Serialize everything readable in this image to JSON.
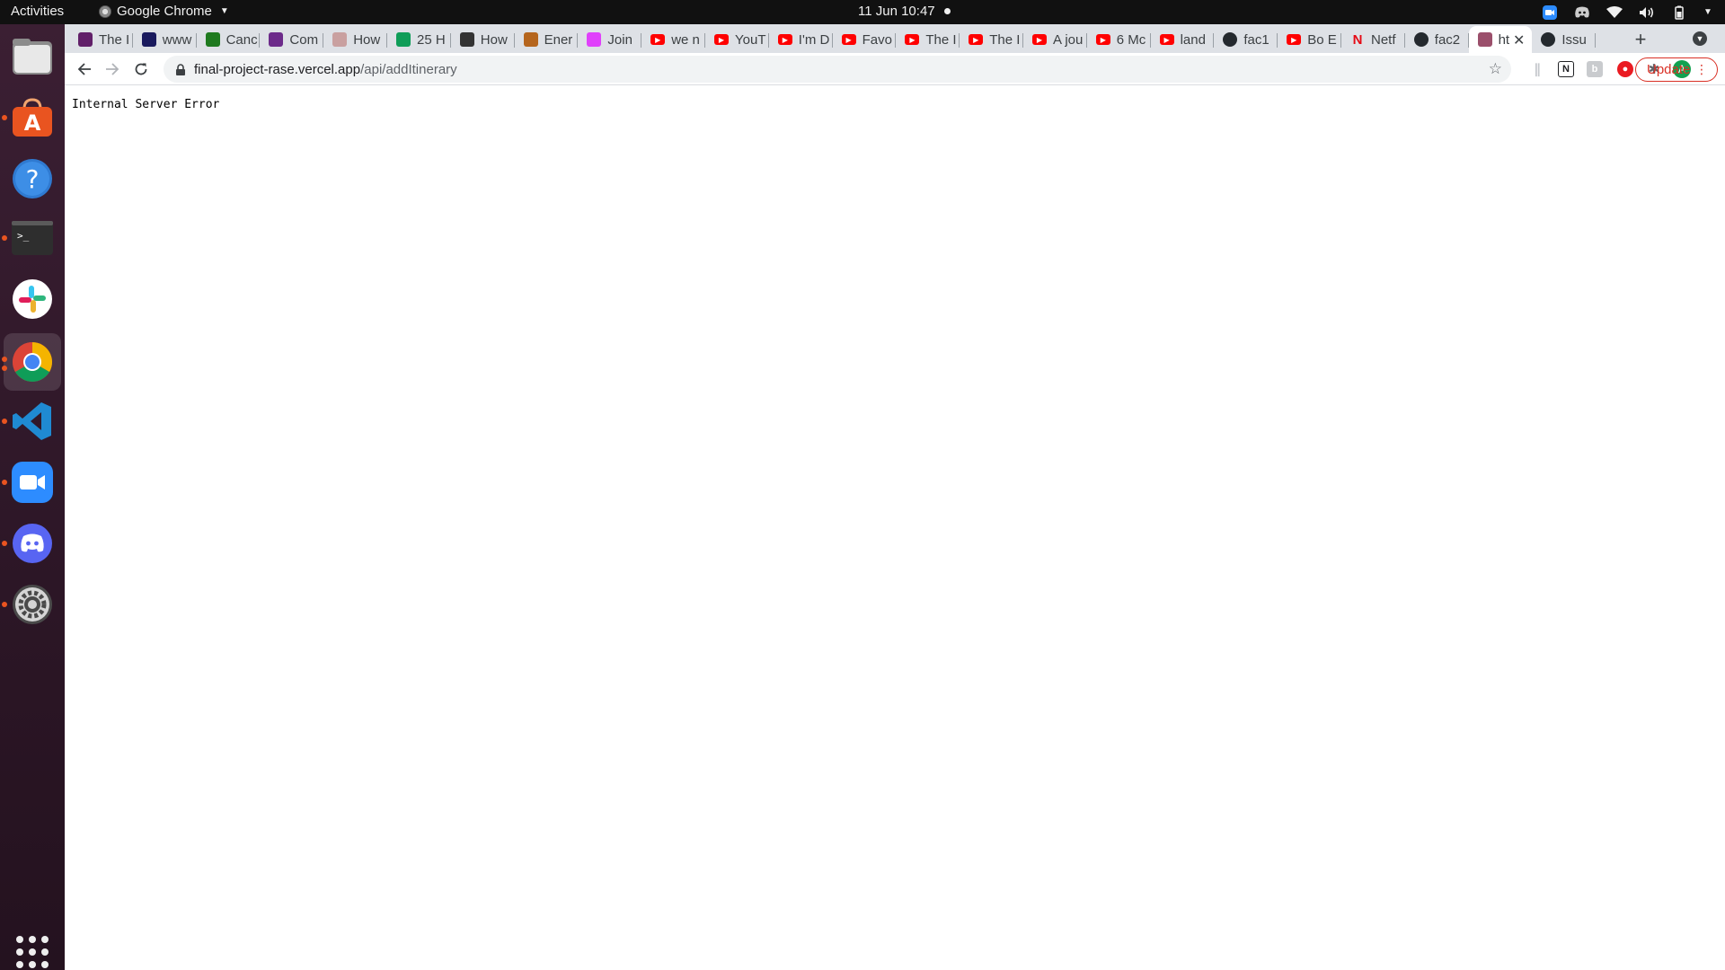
{
  "topbar": {
    "activities_label": "Activities",
    "app_name": "Google Chrome",
    "datetime": "11 Jun  10:47"
  },
  "dock": {
    "items": [
      {
        "name": "files",
        "icon": "files-icon"
      },
      {
        "name": "ubuntu-software",
        "icon": "software-store-icon"
      },
      {
        "name": "help",
        "icon": "help-icon"
      },
      {
        "name": "terminal",
        "icon": "terminal-icon"
      },
      {
        "name": "slack",
        "icon": "slack-icon"
      },
      {
        "name": "chrome",
        "icon": "chrome-icon",
        "active": true
      },
      {
        "name": "vscode",
        "icon": "vscode-icon"
      },
      {
        "name": "zoom",
        "icon": "zoom-icon"
      },
      {
        "name": "discord",
        "icon": "discord-icon"
      },
      {
        "name": "settings",
        "icon": "settings-icon"
      }
    ]
  },
  "tabs": [
    {
      "label": "The I",
      "icon": "slack-favicon",
      "color": "#611f69"
    },
    {
      "label": "www",
      "icon": "site-favicon",
      "color": "#1a1a5e"
    },
    {
      "label": "Canc",
      "icon": "codewars-favicon",
      "color": "#1f7a1f"
    },
    {
      "label": "Com",
      "icon": "circle-favicon",
      "color": "#6c2a8a"
    },
    {
      "label": "How",
      "icon": "doc-favicon",
      "color": "#c9a0a0"
    },
    {
      "label": "25 H",
      "icon": "grid-favicon",
      "color": "#0f9d58"
    },
    {
      "label": "How",
      "icon": "hh-favicon",
      "color": "#333333"
    },
    {
      "label": "Ener",
      "icon": "face-favicon",
      "color": "#b5651d"
    },
    {
      "label": "Join",
      "icon": "blob-favicon",
      "color": "#e040fb"
    },
    {
      "label": "we n",
      "icon": "youtube-favicon",
      "color": "#ff0000"
    },
    {
      "label": "YouT",
      "icon": "youtube-favicon",
      "color": "#ff0000"
    },
    {
      "label": "I'm D",
      "icon": "youtube-favicon",
      "color": "#ff0000"
    },
    {
      "label": "Favo",
      "icon": "youtube-favicon",
      "color": "#ff0000"
    },
    {
      "label": "The I",
      "icon": "youtube-favicon",
      "color": "#ff0000"
    },
    {
      "label": "The I",
      "icon": "youtube-favicon",
      "color": "#ff0000"
    },
    {
      "label": "A jou",
      "icon": "youtube-favicon",
      "color": "#ff0000"
    },
    {
      "label": "6 Mc",
      "icon": "youtube-favicon",
      "color": "#ff0000"
    },
    {
      "label": "land",
      "icon": "youtube-favicon",
      "color": "#ff0000"
    },
    {
      "label": "fac1",
      "icon": "github-favicon",
      "color": "#24292e"
    },
    {
      "label": "Bo E",
      "icon": "youtube-favicon",
      "color": "#ff0000"
    },
    {
      "label": "Netf",
      "icon": "netflix-favicon",
      "color": "#e50914"
    },
    {
      "label": "fac2",
      "icon": "github-favicon",
      "color": "#24292e"
    },
    {
      "label": "ht",
      "icon": "car-favicon",
      "color": "#9b4f6b",
      "active": true
    },
    {
      "label": "Issu",
      "icon": "github-favicon",
      "color": "#24292e"
    }
  ],
  "toolbar": {
    "url_host": "final-project-rase.vercel.app",
    "url_path": "/api/addItinerary",
    "profile_initial": "A",
    "update_label": "Update"
  },
  "page": {
    "body_text": "Internal Server Error"
  }
}
